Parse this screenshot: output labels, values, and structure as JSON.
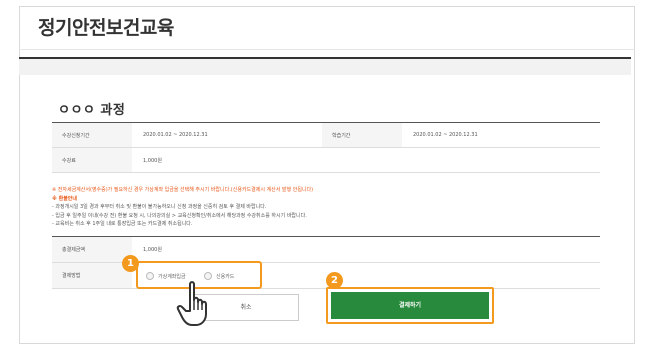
{
  "page": {
    "title": "정기안전보건교육"
  },
  "course": {
    "title": "ㅇㅇㅇ 과정"
  },
  "info": {
    "period_label": "수강신청기간",
    "period_value": "2020.01.02 ~ 2020.12.31",
    "study_label": "학습기간",
    "study_value": "2020.01.02 ~ 2020.12.31",
    "fee_label": "수강료",
    "fee_value": "1,000원"
  },
  "notes": {
    "warning": "※ 전자세금계산서(영수증)가 필요하신 경우 가상계좌 입금을 선택해 주시기 바랍니다.(신용카드결제시 계산서 발행 안됩니다)",
    "refund_heading": "※ 환불안내",
    "lines": [
      "- 과정개시일 3일 경과 후부터 취소 및 환불이 불가능하오니 신청 과정을 신중히 검토 후 결제 바랍니다.",
      "- 입금 후 일주일 이내(수강 전) 환불 요청 시, 나의강의실 > 교육신청확인/취소에서 해당과정 수강취소를 하시기 바랍니다.",
      "- 교육비는 취소 후 1주일 내로 통장입금 또는 카드결제 취소됩니다."
    ]
  },
  "payment": {
    "total_label": "총결제금액",
    "total_value": "1,000원",
    "method_label": "결제방법",
    "options": [
      "가상계좌입금",
      "신용카드"
    ]
  },
  "buttons": {
    "cancel": "취소",
    "pay": "결제하기"
  },
  "badges": [
    "1",
    "2"
  ],
  "colors": {
    "accent_orange": "#f39a1e",
    "pay_green": "#278a3c",
    "fee_orange": "#e8591a"
  },
  "icons": {
    "pointer": "hand-pointer-icon"
  }
}
